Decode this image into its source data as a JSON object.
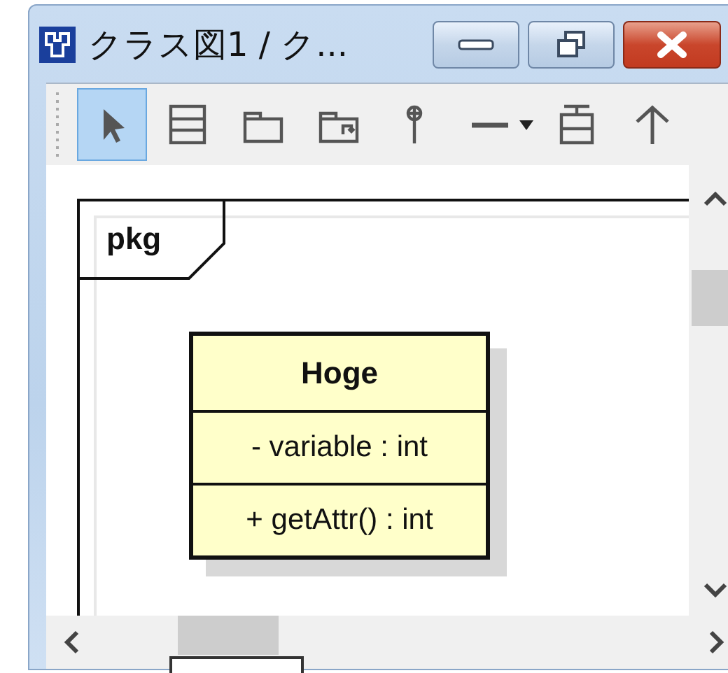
{
  "window": {
    "title": "クラス図1 / ク..."
  },
  "toolbar": {
    "tools": [
      {
        "kind": "pointer",
        "selected": true
      },
      {
        "kind": "class",
        "selected": false
      },
      {
        "kind": "package",
        "selected": false
      },
      {
        "kind": "subsystem",
        "selected": false
      },
      {
        "kind": "lollipop",
        "selected": false
      },
      {
        "kind": "line",
        "selected": false
      },
      {
        "kind": "dropdown",
        "selected": false
      },
      {
        "kind": "split-box",
        "selected": false
      },
      {
        "kind": "arrow-up",
        "selected": false
      }
    ]
  },
  "diagram": {
    "package": {
      "name": "pkg"
    },
    "class": {
      "name": "Hoge",
      "attributes": [
        "- variable : int"
      ],
      "operations": [
        "+ getAttr() : int"
      ]
    }
  }
}
